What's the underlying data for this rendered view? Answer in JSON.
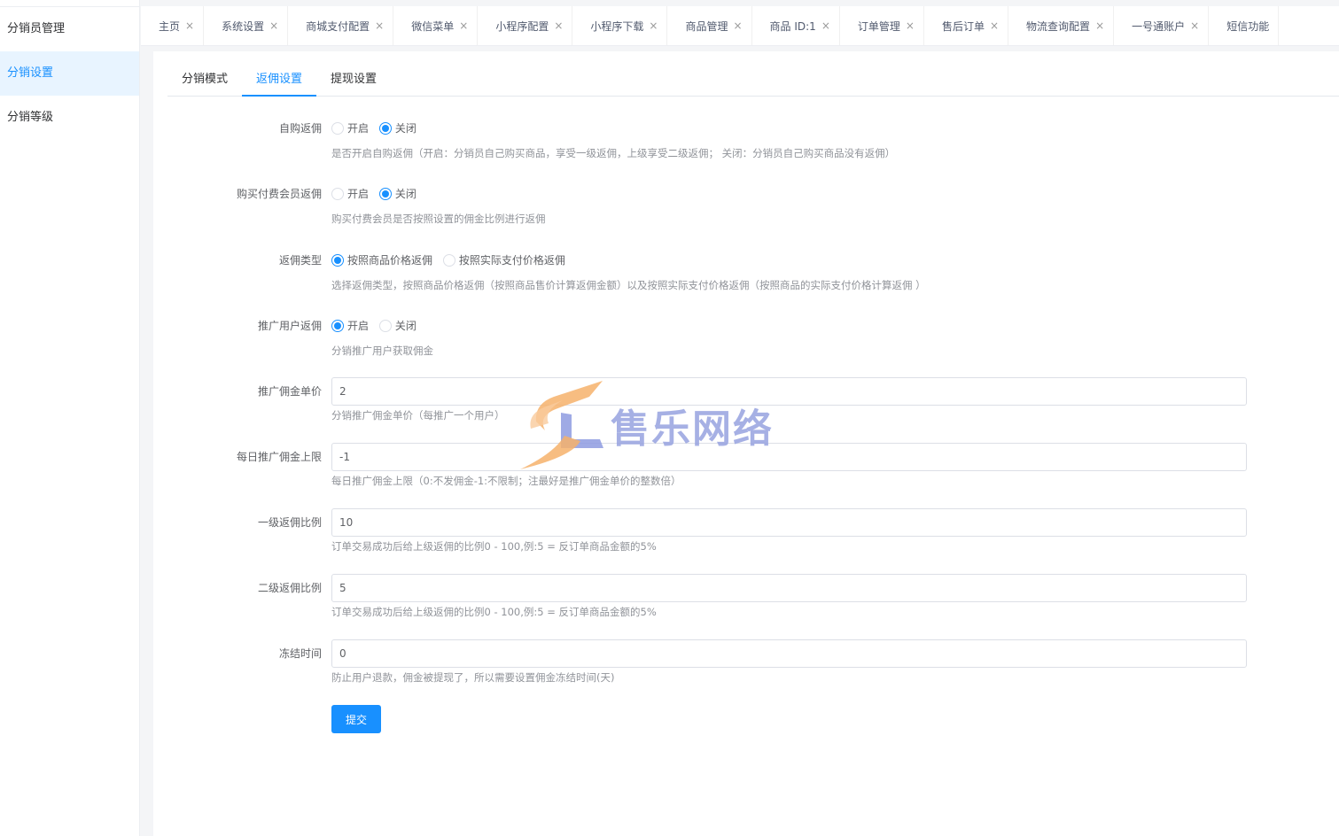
{
  "sidebar": {
    "items": [
      {
        "label": "分销员管理"
      },
      {
        "label": "分销设置"
      },
      {
        "label": "分销等级"
      }
    ]
  },
  "tabbar": {
    "tabs": [
      "主页",
      "系统设置",
      "商城支付配置",
      "微信菜单",
      "小程序配置",
      "小程序下载",
      "商品管理",
      "商品 ID:1",
      "订单管理",
      "售后订单",
      "物流查询配置",
      "一号通账户",
      "短信功能"
    ],
    "close_glyph": "×"
  },
  "subtabs": [
    "分销模式",
    "返佣设置",
    "提现设置"
  ],
  "form": {
    "self_purchase": {
      "label": "自购返佣",
      "options": [
        "开启",
        "关闭"
      ],
      "selected": "关闭",
      "help": "是否开启自购返佣（开启：分销员自己购买商品，享受一级返佣，上级享受二级返佣； 关闭：分销员自己购买商品没有返佣）"
    },
    "paid_member": {
      "label": "购买付费会员返佣",
      "options": [
        "开启",
        "关闭"
      ],
      "selected": "关闭",
      "help": "购买付费会员是否按照设置的佣金比例进行返佣"
    },
    "rebate_type": {
      "label": "返佣类型",
      "options": [
        "按照商品价格返佣",
        "按照实际支付价格返佣"
      ],
      "selected": "按照商品价格返佣",
      "help": "选择返佣类型，按照商品价格返佣（按照商品售价计算返佣金额）以及按照实际支付价格返佣（按照商品的实际支付价格计算返佣 ）"
    },
    "promote_user": {
      "label": "推广用户返佣",
      "options": [
        "开启",
        "关闭"
      ],
      "selected": "开启",
      "help": "分销推广用户获取佣金"
    },
    "promote_price": {
      "label": "推广佣金单价",
      "value": "2",
      "help": "分销推广佣金单价（每推广一个用户）"
    },
    "daily_limit": {
      "label": "每日推广佣金上限",
      "value": "-1",
      "help": "每日推广佣金上限（0:不发佣金-1:不限制；注最好是推广佣金单价的整数倍）"
    },
    "level1_ratio": {
      "label": "一级返佣比例",
      "value": "10",
      "help": "订单交易成功后给上级返佣的比例0 - 100,例:5 = 反订单商品金额的5%"
    },
    "level2_ratio": {
      "label": "二级返佣比例",
      "value": "5",
      "help": "订单交易成功后给上级返佣的比例0 - 100,例:5 = 反订单商品金额的5%"
    },
    "freeze_time": {
      "label": "冻结时间",
      "value": "0",
      "help": "防止用户退款，佣金被提现了，所以需要设置佣金冻结时间(天)"
    },
    "submit_label": "提交"
  },
  "watermark": {
    "text": "售乐网络"
  },
  "colors": {
    "accent": "#1890ff",
    "sidebar_active_bg": "#e8f4ff"
  }
}
